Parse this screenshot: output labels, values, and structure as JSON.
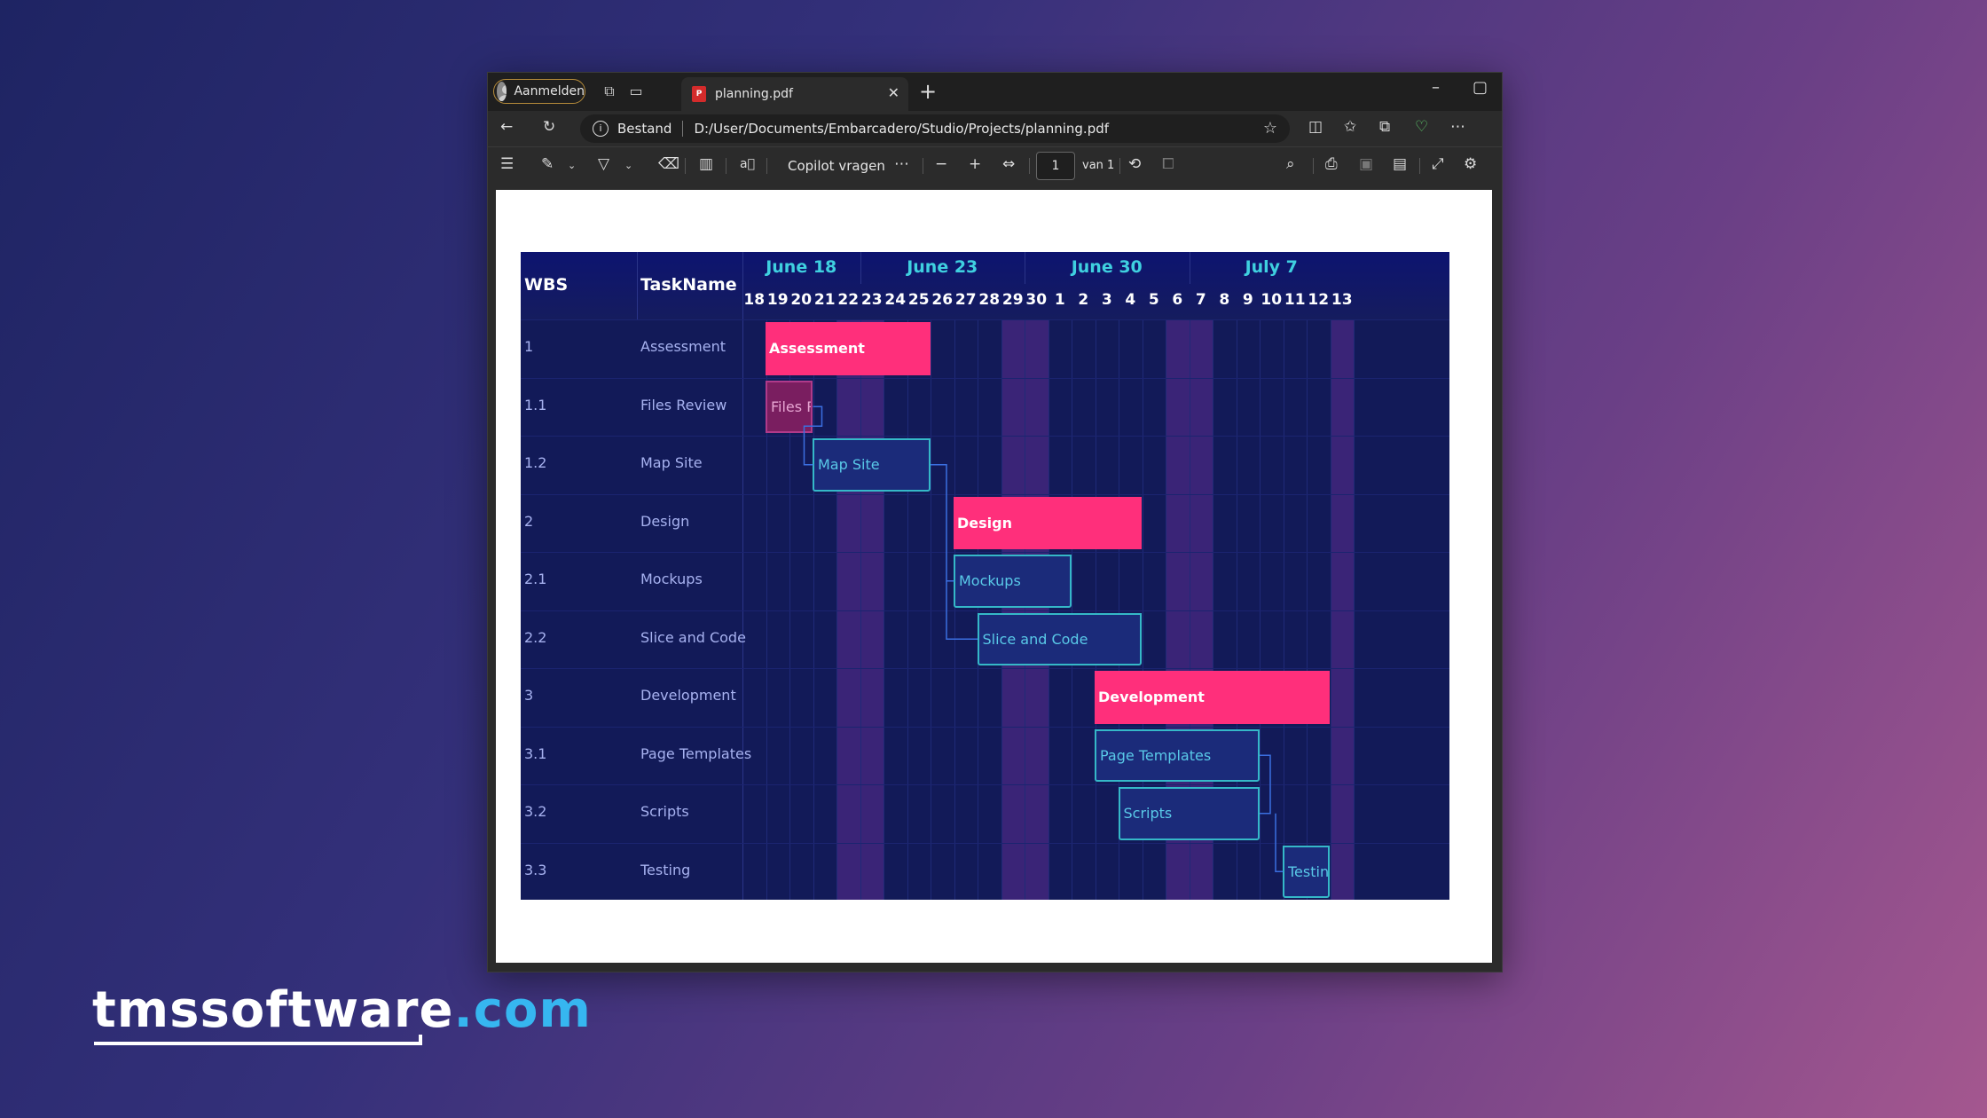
{
  "browser": {
    "profile_label": "Aanmelden",
    "tab_title": "planning.pdf",
    "address_scheme": "Bestand",
    "address_url": "D:/User/Documents/Embarcadero/Studio/Projects/planning.pdf"
  },
  "pdf_toolbar": {
    "copilot_label": "Copilot vragen",
    "page_current": "1",
    "page_total_label": "van 1"
  },
  "gantt": {
    "headers": {
      "wbs": "WBS",
      "task": "TaskName"
    },
    "months": [
      "June 18",
      "June 23",
      "June 30",
      "July 7"
    ],
    "days": [
      "18",
      "19",
      "20",
      "21",
      "22",
      "23",
      "24",
      "25",
      "26",
      "27",
      "28",
      "29",
      "30",
      "1",
      "2",
      "3",
      "4",
      "5",
      "6",
      "7",
      "8",
      "9",
      "10",
      "11",
      "12",
      "13"
    ],
    "rows": [
      {
        "wbs": "1",
        "task": "Assessment"
      },
      {
        "wbs": "1.1",
        "task": "Files Review"
      },
      {
        "wbs": "1.2",
        "task": "Map Site"
      },
      {
        "wbs": "2",
        "task": "Design"
      },
      {
        "wbs": "2.1",
        "task": "Mockups"
      },
      {
        "wbs": "2.2",
        "task": "Slice and Code"
      },
      {
        "wbs": "3",
        "task": "Development"
      },
      {
        "wbs": "3.1",
        "task": "Page Templates"
      },
      {
        "wbs": "3.2",
        "task": "Scripts"
      },
      {
        "wbs": "3.3",
        "task": "Testing"
      }
    ],
    "bars": [
      {
        "label": "Assessment",
        "kind": "summary"
      },
      {
        "label": "Files R",
        "kind": "late"
      },
      {
        "label": "Map Site",
        "kind": "task"
      },
      {
        "label": "Design",
        "kind": "summary"
      },
      {
        "label": "Mockups",
        "kind": "task"
      },
      {
        "label": "Slice and Code",
        "kind": "task"
      },
      {
        "label": "Development",
        "kind": "summary"
      },
      {
        "label": "Page Templates",
        "kind": "task"
      },
      {
        "label": "Scripts",
        "kind": "task"
      },
      {
        "label": "Testin",
        "kind": "task"
      }
    ],
    "colors": {
      "summary": "#ff2f7b",
      "task_border": "#35b8c8",
      "weekend": "#3a2477",
      "background": "#121a58"
    }
  },
  "brand": {
    "part1": "tmssoftware",
    "part2": ".com"
  }
}
